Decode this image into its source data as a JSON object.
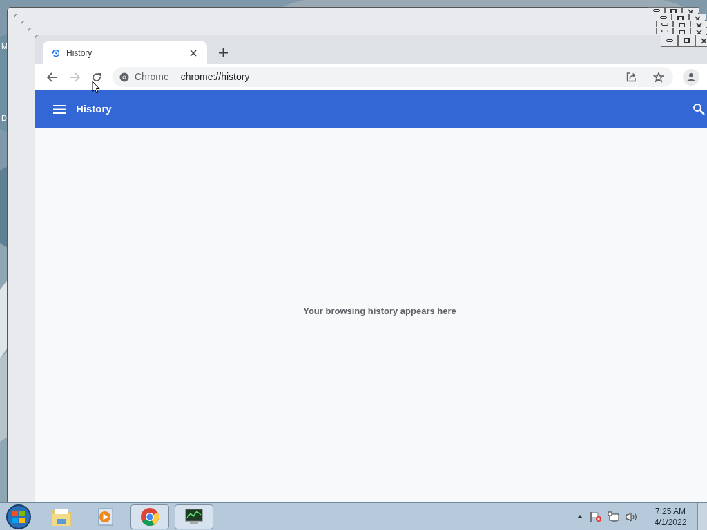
{
  "desktop": {
    "icon_labels": [
      "M",
      "D"
    ]
  },
  "browser": {
    "tabs": [
      {
        "title": "History",
        "selected": true
      }
    ],
    "back_enabled": true,
    "forward_enabled": false,
    "address": {
      "origin": "Chrome",
      "url": "chrome://history"
    }
  },
  "page": {
    "title": "History",
    "empty_message": "Your browsing history appears here"
  },
  "taskbar": {
    "apps": [
      {
        "kind": "explorer",
        "open": false
      },
      {
        "kind": "media",
        "open": false
      },
      {
        "kind": "chrome",
        "open": true
      },
      {
        "kind": "monitor",
        "open": true
      }
    ],
    "clock": {
      "time": "7:25 AM",
      "date": "4/1/2022"
    }
  }
}
